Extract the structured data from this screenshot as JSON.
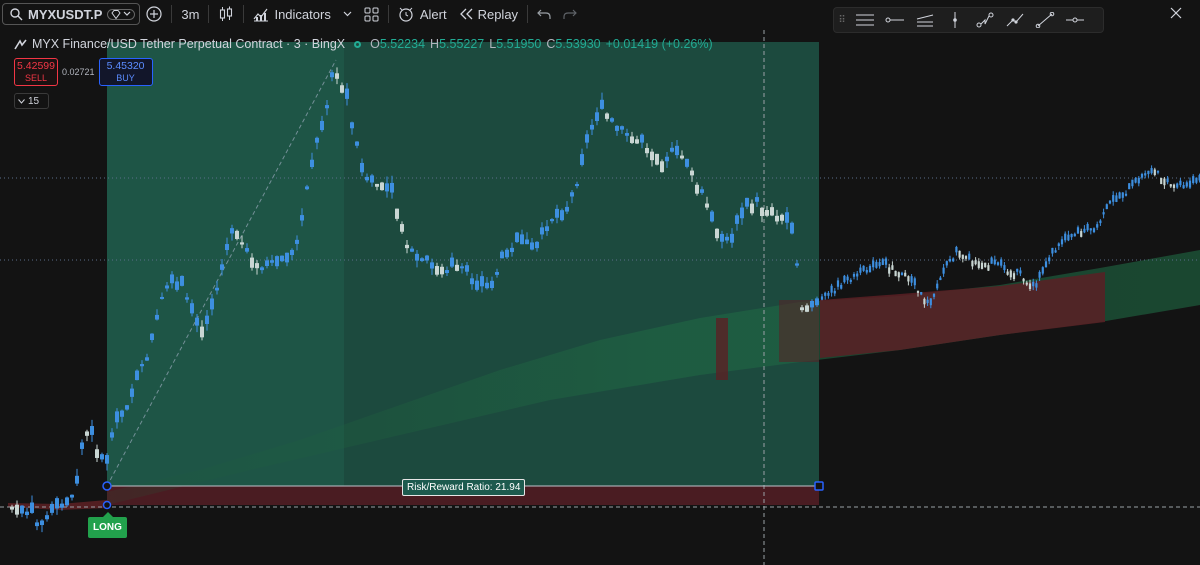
{
  "toolbar": {
    "symbol": "MYXUSDT.P",
    "interval": "3m",
    "indicators_label": "Indicators",
    "alert_label": "Alert",
    "replay_label": "Replay"
  },
  "legend": {
    "title": "MYX Finance/USD Tether Perpetual Contract · 3 · BingX",
    "o_key": "O",
    "open": "5.52234",
    "h_key": "H",
    "high": "5.55227",
    "l_key": "L",
    "low": "5.51950",
    "c_key": "C",
    "close": "5.53930",
    "change": "+0.01419 (+0.26%)"
  },
  "trade_panel": {
    "sell_price": "5.42599",
    "sell_label": "SELL",
    "spread": "0.02721",
    "buy_price": "5.45320",
    "buy_label": "BUY",
    "quantity": "15"
  },
  "position": {
    "rr_label": "Risk/Reward Ratio: 21.94",
    "long_label": "LONG"
  },
  "colors": {
    "background": "#131313",
    "up": "#3d8fe0",
    "down": "#c9d6d3",
    "profit_zone": "#1c4a3e",
    "loss_zone": "#4a1c22",
    "cloud_green": "#1f5a3a",
    "cloud_red": "#5a2024"
  },
  "icons": [
    "search-icon",
    "diamond-icon",
    "chevron-down-icon",
    "plus-circle-icon",
    "candles-icon",
    "indicators-icon",
    "layout-icon",
    "alert-icon",
    "replay-icon",
    "undo-icon",
    "redo-icon",
    "horizontal-lines-icon",
    "horizontal-ray-icon",
    "parallel-channel-icon",
    "vertical-line-icon",
    "path-icon",
    "polyline-icon",
    "trend-line-icon",
    "cross-line-icon",
    "close-icon"
  ]
}
